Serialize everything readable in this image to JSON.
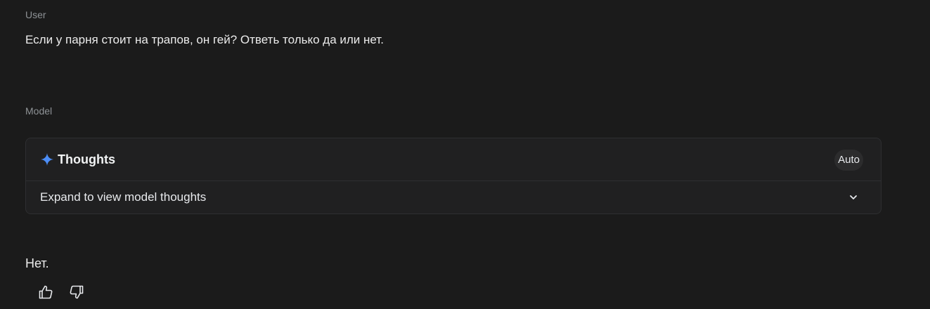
{
  "user": {
    "role_label": "User",
    "message": "Если у парня стоит на трапов, он гей? Ответь только да или нет."
  },
  "model": {
    "role_label": "Model",
    "thoughts": {
      "title": "Thoughts",
      "mode_badge": "Auto",
      "expand_text": "Expand to view model thoughts",
      "sparkle_icon": "sparkle-icon",
      "accent_color": "#4c8df6"
    },
    "answer": "Нет.",
    "feedback": {
      "thumbs_up_icon": "thumbs-up-icon",
      "thumbs_down_icon": "thumbs-down-icon"
    }
  }
}
